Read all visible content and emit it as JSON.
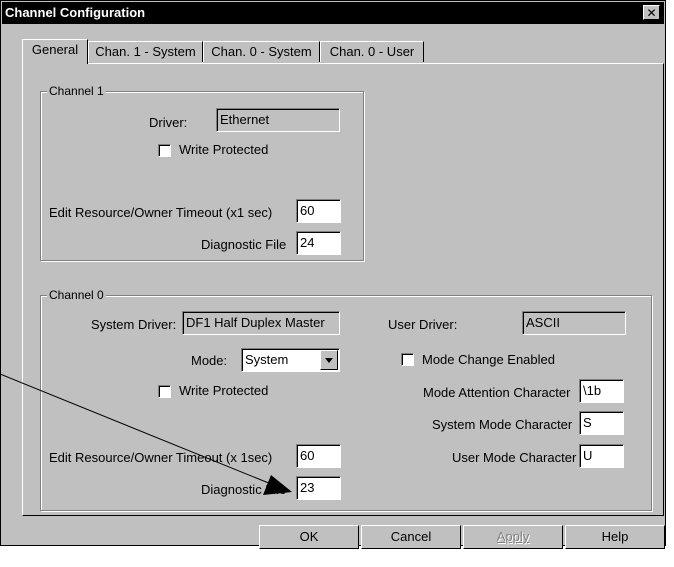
{
  "window": {
    "title": "Channel Configuration",
    "close_glyph": "✕"
  },
  "tabs": [
    {
      "label": "General",
      "active": true
    },
    {
      "label": "Chan. 1 - System",
      "active": false
    },
    {
      "label": "Chan. 0 - System",
      "active": false
    },
    {
      "label": "Chan. 0 - User",
      "active": false
    }
  ],
  "channel1": {
    "group_label": "Channel 1",
    "driver_label": "Driver:",
    "driver_value": "Ethernet",
    "write_protected_label": "Write Protected",
    "write_protected_checked": false,
    "timeout_label": "Edit Resource/Owner Timeout (x1 sec)",
    "timeout_value": "60",
    "diag_label": "Diagnostic File",
    "diag_value": "24"
  },
  "channel0": {
    "group_label": "Channel 0",
    "system_driver_label": "System Driver:",
    "system_driver_value": "DF1 Half Duplex Master",
    "user_driver_label": "User Driver:",
    "user_driver_value": "ASCII",
    "mode_label": "Mode:",
    "mode_value": "System",
    "mode_change_label": "Mode Change Enabled",
    "mode_change_checked": false,
    "write_protected_label": "Write Protected",
    "write_protected_checked": false,
    "attention_label": "Mode Attention Character",
    "attention_value": "\\1b",
    "system_mode_label": "System Mode Character",
    "system_mode_value": "S",
    "user_mode_label": "User Mode Character",
    "user_mode_value": "U",
    "timeout_label": "Edit Resource/Owner Timeout (x 1sec)",
    "timeout_value": "60",
    "diag_label": "Diagnostic File",
    "diag_value": "23"
  },
  "buttons": {
    "ok": "OK",
    "cancel": "Cancel",
    "apply": "Apply",
    "help": "Help"
  },
  "icons": {
    "close": "close-icon",
    "dropdown": "chevron-down-icon"
  }
}
